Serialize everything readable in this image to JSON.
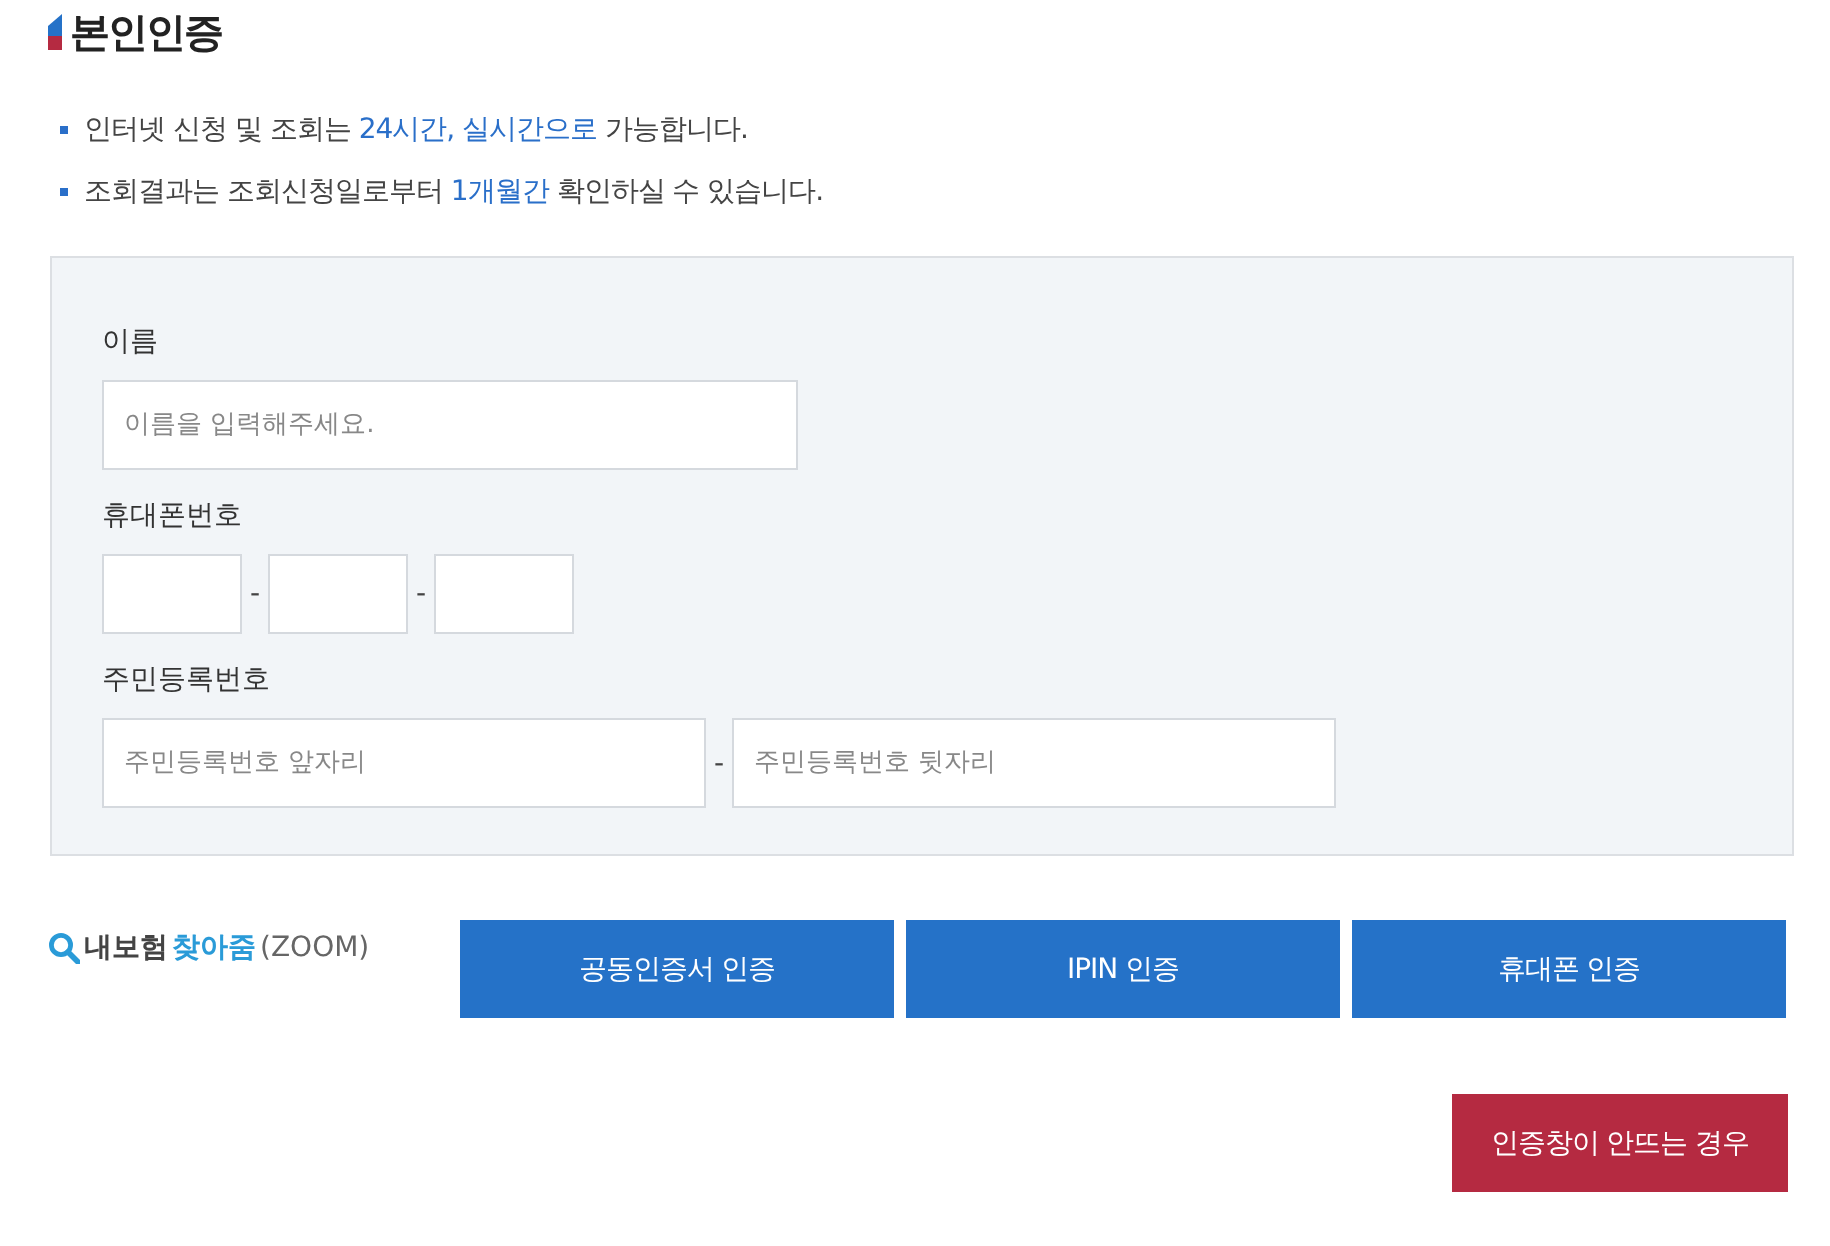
{
  "title": "본인인증",
  "notices": [
    {
      "segments": [
        {
          "text": "인터넷 신청 및 조회는 ",
          "highlight": false
        },
        {
          "text": "24시간, 실시간으로",
          "highlight": true
        },
        {
          "text": " 가능합니다.",
          "highlight": false
        }
      ]
    },
    {
      "segments": [
        {
          "text": "조회결과는 조회신청일로부터 ",
          "highlight": false
        },
        {
          "text": "1개월간",
          "highlight": true
        },
        {
          "text": " 확인하실 수 있습니다.",
          "highlight": false
        }
      ]
    }
  ],
  "form": {
    "name": {
      "label": "이름",
      "placeholder": "이름을 입력해주세요."
    },
    "phone": {
      "label": "휴대폰번호",
      "separators": [
        "-",
        "-"
      ]
    },
    "rrn": {
      "label": "주민등록번호",
      "front_placeholder": "주민등록번호 앞자리",
      "separator": "-",
      "back_placeholder": "주민등록번호 뒷자리"
    }
  },
  "logo": {
    "part_1": "내보험",
    "part_2": "찾아줌",
    "part_3": "(ZOOM)"
  },
  "auth_buttons": [
    "공동인증서 인증",
    "IPIN 인증",
    "휴대폰 인증"
  ],
  "help_button": "인증창이 안뜨는 경우"
}
